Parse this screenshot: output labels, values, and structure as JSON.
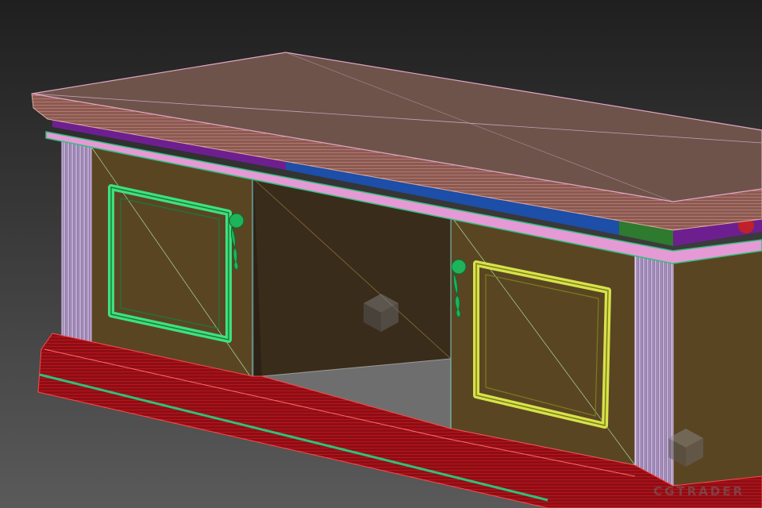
{
  "viewport": {
    "name": "3d-viewport-perspective",
    "colors": {
      "background_top": "#1f1f1f",
      "background_bottom": "#5a5a5a",
      "wireframe_wood": "#c98a7a",
      "body_fill": "#5a4523",
      "frieze_purple": "#6e1f8f",
      "frieze_blue": "#1d4ea8",
      "frieze_green": "#2e7a2e",
      "trim_pink": "#e59ad6",
      "left_door_frame": "#3fe07e",
      "right_door_frame": "#d8e24a",
      "handle_green": "#1fb35b",
      "base_red": "#b4121a",
      "base_accent_green": "#2fc07b",
      "pilaster_lilac": "#c9a6e8"
    }
  },
  "watermark": {
    "text": "CGTRADER",
    "icon": "cube-logo-icon"
  }
}
